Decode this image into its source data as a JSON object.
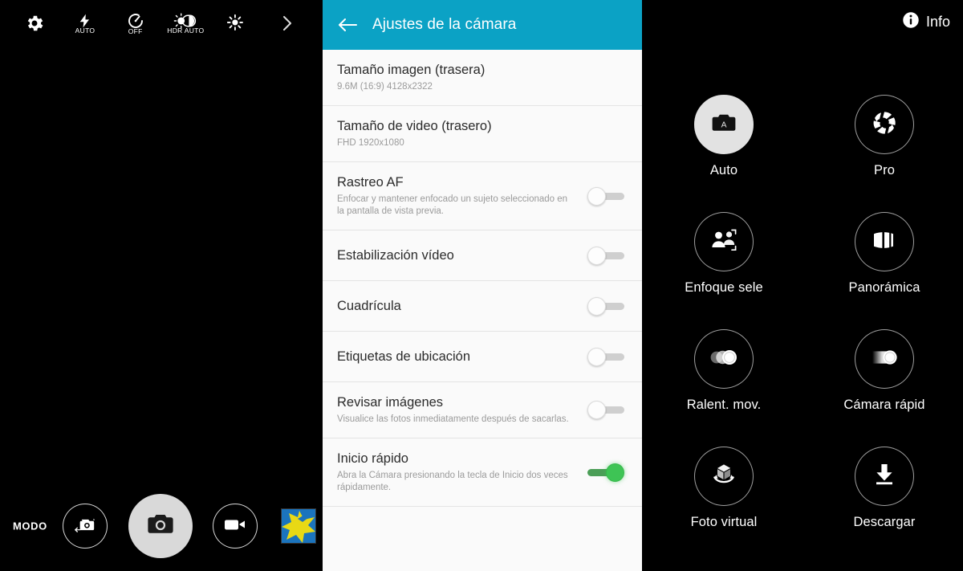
{
  "viewfinder": {
    "topbar": [
      {
        "icon": "settings-gear-icon",
        "sub": ""
      },
      {
        "icon": "flash-icon",
        "sub": "AUTO"
      },
      {
        "icon": "timer-icon",
        "sub": "OFF"
      },
      {
        "icon": "hdr-icon",
        "sub": "HDR AUTO"
      },
      {
        "icon": "effects-icon",
        "sub": ""
      },
      {
        "icon": "chevron-right-icon",
        "sub": ""
      }
    ],
    "controls": {
      "mode_label": "MODO",
      "switch_camera": "switch-camera-icon",
      "shutter": "camera-icon",
      "record_video": "video-camera-icon",
      "gallery_thumbnail": "gallery-thumbnail"
    }
  },
  "settings": {
    "header": {
      "back": "back-arrow-icon",
      "title": "Ajustes de la cámara"
    },
    "items": [
      {
        "title": "Tamaño imagen (trasera)",
        "sub": "9.6M (16:9) 4128x2322",
        "has_toggle": false,
        "toggle_on": false
      },
      {
        "title": "Tamaño de video (trasero)",
        "sub": "FHD 1920x1080",
        "has_toggle": false,
        "toggle_on": false
      },
      {
        "title": "Rastreo AF",
        "sub": "Enfocar y mantener enfocado un sujeto seleccionado en la pantalla de vista previa.",
        "has_toggle": true,
        "toggle_on": false
      },
      {
        "title": "Estabilización vídeo",
        "sub": "",
        "has_toggle": true,
        "toggle_on": false
      },
      {
        "title": "Cuadrícula",
        "sub": "",
        "has_toggle": true,
        "toggle_on": false
      },
      {
        "title": "Etiquetas de ubicación",
        "sub": "",
        "has_toggle": true,
        "toggle_on": false
      },
      {
        "title": "Revisar imágenes",
        "sub": "Visualice las fotos inmediatamente después de sacarlas.",
        "has_toggle": true,
        "toggle_on": false
      },
      {
        "title": "Inicio rápido",
        "sub": "Abra la Cámara presionando la tecla de Inicio dos veces rápidamente.",
        "has_toggle": true,
        "toggle_on": true
      }
    ]
  },
  "modes": {
    "info_label": "Info",
    "info_icon": "info-icon",
    "items": [
      {
        "label": "Auto",
        "icon": "camera-auto-icon",
        "active": true
      },
      {
        "label": "Pro",
        "icon": "aperture-icon",
        "active": false
      },
      {
        "label": "Enfoque sele",
        "icon": "selective-focus-icon",
        "active": false
      },
      {
        "label": "Panorámica",
        "icon": "panorama-icon",
        "active": false
      },
      {
        "label": "Ralent. mov.",
        "icon": "slow-motion-icon",
        "active": false
      },
      {
        "label": "Cámara rápid",
        "icon": "fast-motion-icon",
        "active": false
      },
      {
        "label": "Foto virtual",
        "icon": "virtual-shot-icon",
        "active": false
      },
      {
        "label": "Descargar",
        "icon": "download-icon",
        "active": false
      }
    ]
  },
  "colors": {
    "accent_teal": "#0ba2c5",
    "toggle_on_green": "#3ec455",
    "panel_bg": "#fafafa",
    "viewfinder_bg": "#000000"
  }
}
